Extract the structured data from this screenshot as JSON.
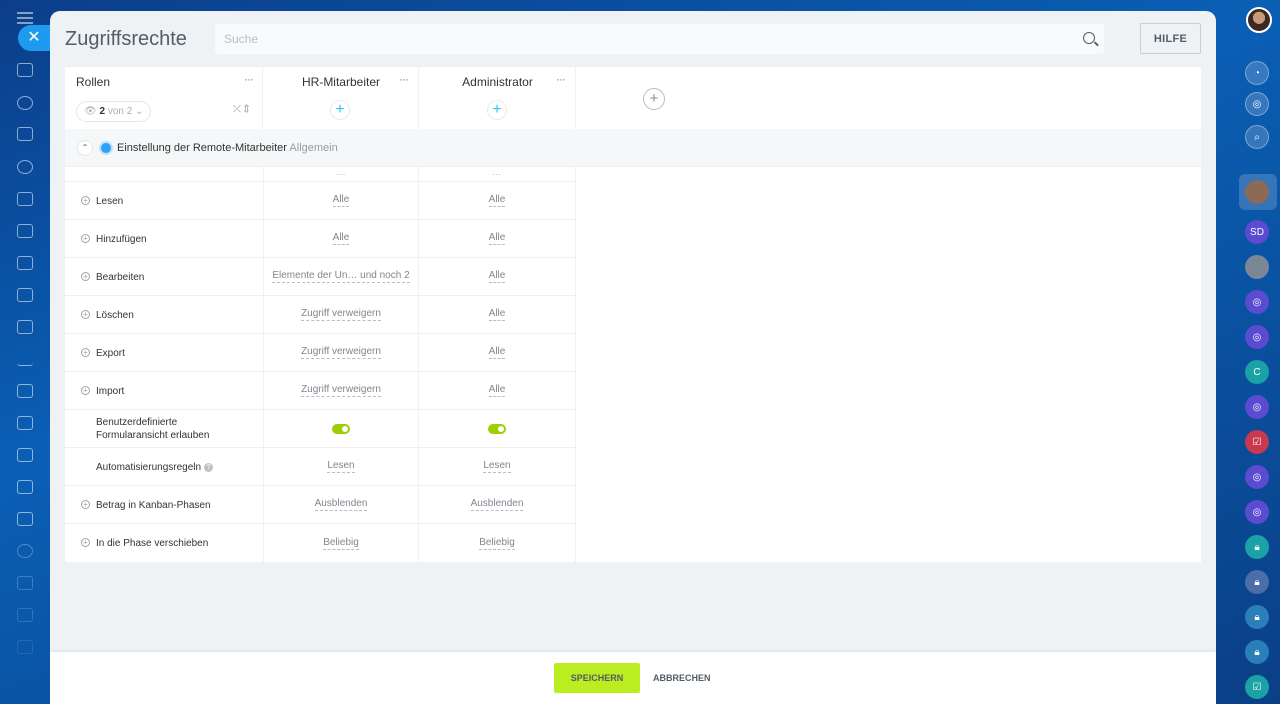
{
  "panel": {
    "title": "Zugriffsrechte",
    "search_placeholder": "Suche",
    "help_label": "HILFE"
  },
  "roles_header": {
    "label": "Rollen",
    "counter_value": "2",
    "counter_suffix": "von 2"
  },
  "roles": [
    {
      "name": "HR-Mitarbeiter"
    },
    {
      "name": "Administrator"
    }
  ],
  "section": {
    "title": "Einstellung der Remote-Mitarbeiter",
    "subtitle": "Allgemein"
  },
  "rows": [
    {
      "label": "Lesen",
      "values": [
        "Alle",
        "Alle"
      ]
    },
    {
      "label": "Hinzufügen",
      "values": [
        "Alle",
        "Alle"
      ]
    },
    {
      "label": "Bearbeiten",
      "values": [
        "Elemente der Un… und noch 2",
        "Alle"
      ]
    },
    {
      "label": "Löschen",
      "values": [
        "Zugriff verweigern",
        "Alle"
      ]
    },
    {
      "label": "Export",
      "values": [
        "Zugriff verweigern",
        "Alle"
      ]
    },
    {
      "label": "Import",
      "values": [
        "Zugriff verweigern",
        "Alle"
      ]
    },
    {
      "label": "Benutzerdefinierte",
      "label2": "Formularansicht erlauben",
      "toggles": [
        true,
        true
      ]
    },
    {
      "label": "Automatisierungsregeln",
      "values": [
        "Lesen",
        "Lesen"
      ]
    },
    {
      "label": "Betrag in Kanban-Phasen",
      "values": [
        "Ausblenden",
        "Ausblenden"
      ]
    },
    {
      "label": "In die Phase verschieben",
      "values": [
        "Beliebig",
        "Beliebig"
      ]
    }
  ],
  "footer": {
    "save_label": "SPEICHERN",
    "cancel_label": "ABBRECHEN"
  },
  "right_rail": {
    "initials_sd": "SD",
    "initial_c": "C"
  },
  "colors": {
    "accent": "#2fc6f6",
    "save_button": "#bbed21",
    "toggle_on": "#9dcf00",
    "close_button": "#1e9bf0"
  }
}
